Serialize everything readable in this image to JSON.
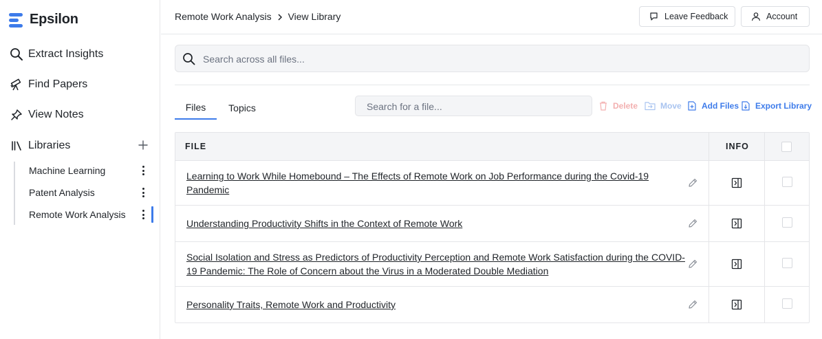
{
  "app": {
    "name": "Epsilon",
    "accent": "#3d7bea"
  },
  "sidebar": {
    "nav": [
      {
        "label": "Extract Insights",
        "icon": "search-icon"
      },
      {
        "label": "Find Papers",
        "icon": "telescope-icon"
      },
      {
        "label": "View Notes",
        "icon": "pin-icon"
      }
    ],
    "libraries": {
      "label": "Libraries",
      "icon": "books-icon",
      "items": [
        {
          "label": "Machine Learning"
        },
        {
          "label": "Patent Analysis"
        },
        {
          "label": "Remote Work Analysis",
          "active": true
        }
      ]
    }
  },
  "header": {
    "breadcrumb": [
      "Remote Work Analysis",
      "View Library"
    ],
    "feedback_label": "Leave Feedback",
    "account_label": "Account"
  },
  "search": {
    "placeholder": "Search across all files..."
  },
  "tabs": [
    {
      "label": "Files",
      "active": true
    },
    {
      "label": "Topics"
    }
  ],
  "file_search": {
    "placeholder": "Search for a file..."
  },
  "actions": {
    "delete": "Delete",
    "move": "Move",
    "add_files": "Add Files",
    "export": "Export Library"
  },
  "table": {
    "columns": [
      "FILE",
      "INFO"
    ],
    "rows": [
      {
        "title": "Learning to Work While Homebound – The Effects of Remote Work on Job Performance during the Covid-19 Pandemic"
      },
      {
        "title": "Understanding Productivity Shifts in the Context of Remote Work"
      },
      {
        "title": "Social Isolation and Stress as Predictors of Productivity Perception and Remote Work Satisfaction during the COVID-19 Pandemic: The Role of Concern about the Virus in a Moderated Double Mediation"
      },
      {
        "title": "Personality Traits, Remote Work and Productivity"
      }
    ]
  }
}
